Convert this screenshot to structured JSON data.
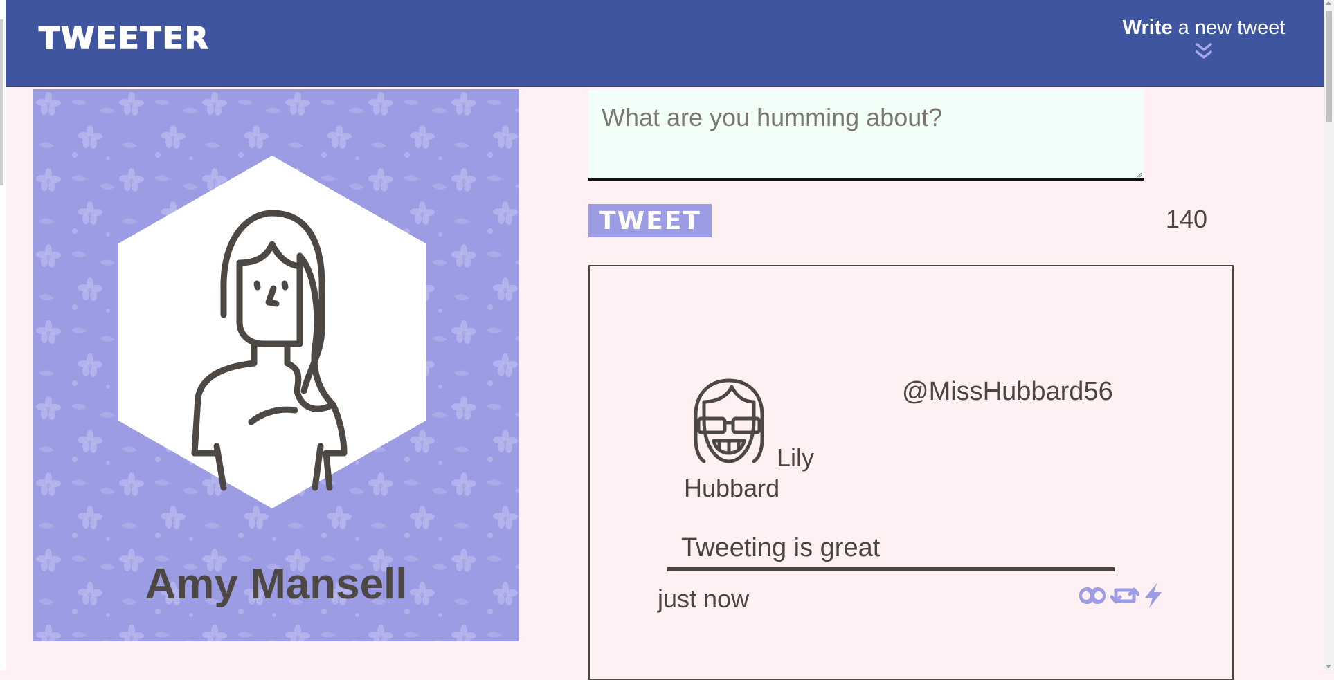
{
  "header": {
    "brand": "TWEETER",
    "compose_toggle_bold": "Write",
    "compose_toggle_rest": " a new tweet",
    "toggle_icon": "double-chevron-down-icon"
  },
  "profile": {
    "name": "Amy Mansell",
    "avatar_icon": "woman-avatar-icon"
  },
  "compose": {
    "placeholder": "What are you humming about?",
    "value": "",
    "button_label": "TWEET",
    "counter": "140"
  },
  "tweets": [
    {
      "name": "Lily Hubbard",
      "handle": "@MissHubbard56",
      "text": "Tweeting is great",
      "time": "just now",
      "avatar_icon": "girl-with-sunglasses-avatar-icon",
      "actions": [
        "flag-icon",
        "retweet-icon",
        "like-icon"
      ]
    }
  ],
  "colors": {
    "navbar": "#3f55a0",
    "accent": "#9c9ce4",
    "page_bg": "#fff0f3",
    "compose_bg": "#f2fff8",
    "text": "#4a4540"
  }
}
